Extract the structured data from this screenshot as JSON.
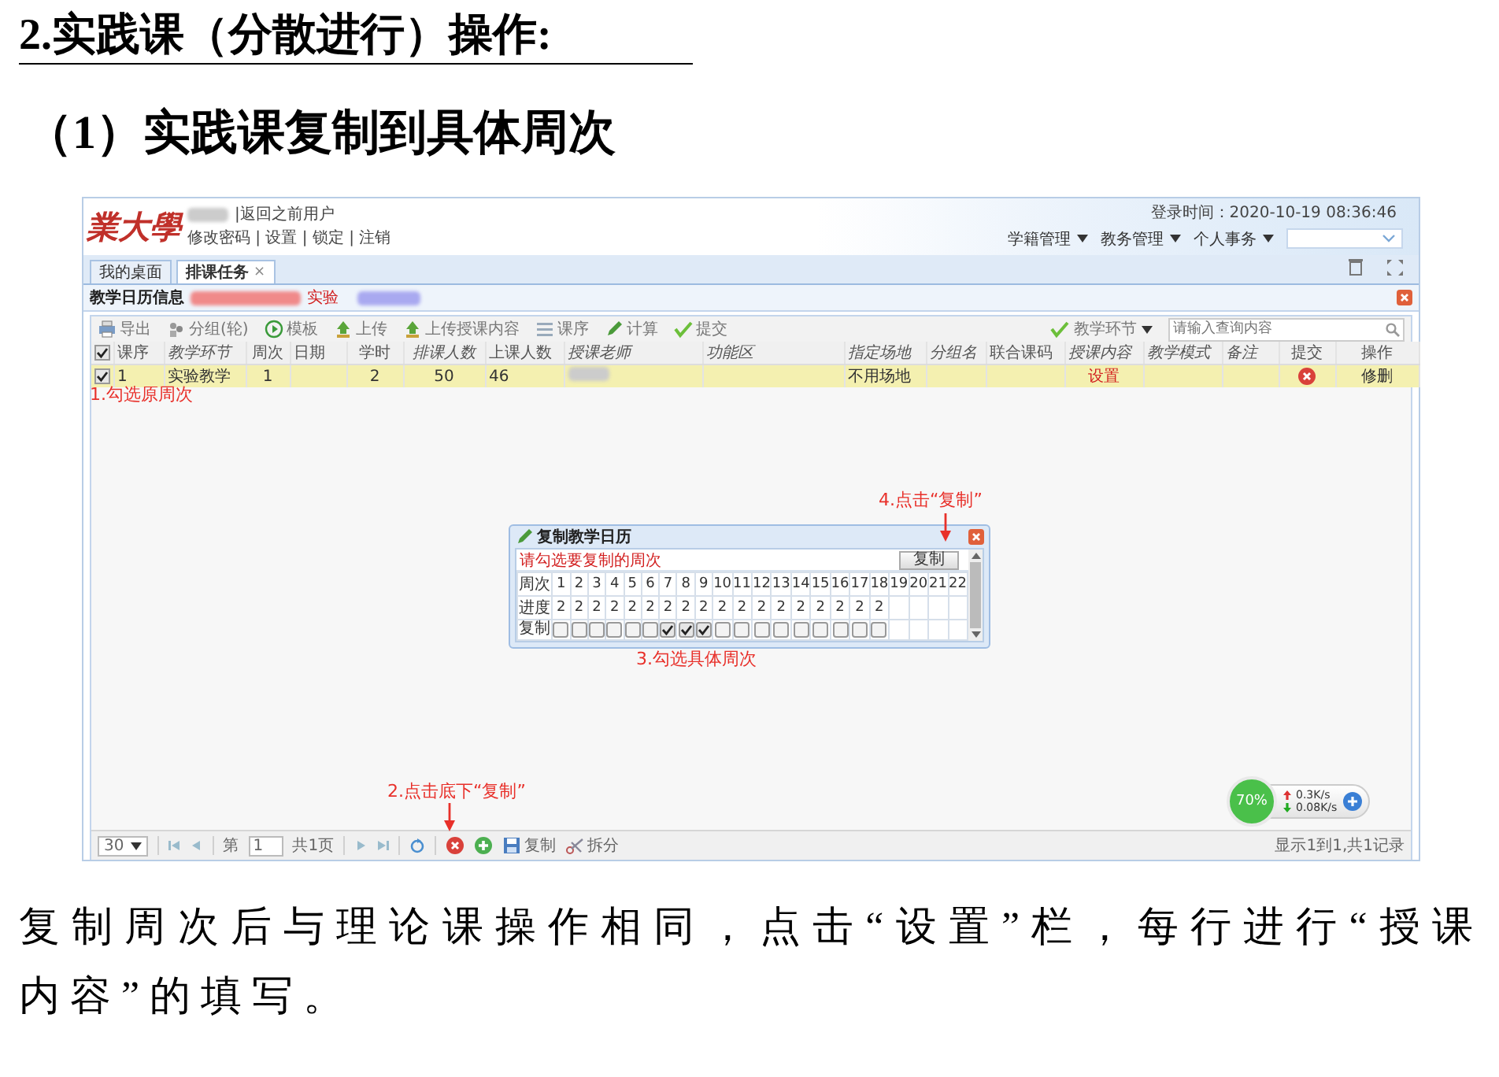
{
  "heading": "2.实践课（分散进行）操作:",
  "subheading": "（1）实践课复制到具体周次",
  "screenshot": {
    "logo": "業大學",
    "return_link": "|返回之前用户",
    "account_links": "修改密码 | 设置 | 锁定 | 注销",
    "login_time": "登录时间：2020-10-19 08:36:46",
    "menus": [
      "学籍管理",
      "教务管理",
      "个人事务"
    ],
    "tabs": [
      {
        "label": "我的桌面",
        "selected": false
      },
      {
        "label": "排课任务",
        "selected": true,
        "close": "×"
      }
    ],
    "panel_title": "教学日历信息",
    "panel_tag": "实验",
    "toolbar": [
      {
        "kind": "print",
        "label": "导出"
      },
      {
        "kind": "group",
        "label": "分组(轮)"
      },
      {
        "kind": "play",
        "label": "模板"
      },
      {
        "kind": "upload",
        "label": "上传"
      },
      {
        "kind": "upload",
        "label": "上传授课内容"
      },
      {
        "kind": "list",
        "label": "课序"
      },
      {
        "kind": "pencil",
        "label": "计算"
      },
      {
        "kind": "check",
        "label": "提交"
      }
    ],
    "filter": {
      "label": "教学环节",
      "placeholder": "请输入查询内容"
    },
    "header_checked": true,
    "columns": [
      {
        "label": "课序",
        "editable": false
      },
      {
        "label": "教学环节",
        "editable": true
      },
      {
        "label": "周次",
        "editable": false
      },
      {
        "label": "日期",
        "editable": false
      },
      {
        "label": "学时",
        "editable": false
      },
      {
        "label": "排课人数",
        "editable": true
      },
      {
        "label": "上课人数",
        "editable": false
      },
      {
        "label": "授课老师",
        "editable": true
      },
      {
        "label": "功能区",
        "editable": true
      },
      {
        "label": "指定场地",
        "editable": true
      },
      {
        "label": "分组名",
        "editable": true
      },
      {
        "label": "联合课码",
        "editable": false
      },
      {
        "label": "授课内容",
        "editable": true
      },
      {
        "label": "教学模式",
        "editable": true
      },
      {
        "label": "备注",
        "editable": true
      },
      {
        "label": "提交",
        "editable": false
      },
      {
        "label": "操作",
        "editable": false
      }
    ],
    "rows": [
      {
        "selected": true,
        "checked": true,
        "cells": [
          "1",
          "实验教学",
          "1",
          null,
          "2",
          "50",
          "46",
          {
            "kind": "redacted"
          },
          null,
          "不用场地",
          null,
          null,
          {
            "kind": "link",
            "text": "设置"
          },
          null,
          null,
          {
            "kind": "delete_icon"
          },
          "修删"
        ]
      }
    ],
    "pager": {
      "page_size": "30",
      "page_label": "第",
      "page": "1",
      "total": "共1页",
      "actions": [
        {
          "kind": "delete"
        },
        {
          "kind": "add"
        },
        {
          "kind": "save",
          "label": "复制"
        },
        {
          "kind": "split",
          "label": "拆分"
        }
      ],
      "summary": "显示1到1,共1记录"
    },
    "dialog": {
      "title": "复制教学日历",
      "prompt": "请勾选要复制的周次",
      "button": "复制",
      "row_labels": [
        "周次",
        "进度",
        "复制"
      ],
      "weeks": [
        {
          "week": "1",
          "progress": "2",
          "checked": false
        },
        {
          "week": "2",
          "progress": "2",
          "checked": false
        },
        {
          "week": "3",
          "progress": "2",
          "checked": false
        },
        {
          "week": "4",
          "progress": "2",
          "checked": false
        },
        {
          "week": "5",
          "progress": "2",
          "checked": false
        },
        {
          "week": "6",
          "progress": "2",
          "checked": false
        },
        {
          "week": "7",
          "progress": "2",
          "checked": true
        },
        {
          "week": "8",
          "progress": "2",
          "checked": true
        },
        {
          "week": "9",
          "progress": "2",
          "checked": true
        },
        {
          "week": "10",
          "progress": "2",
          "checked": false
        },
        {
          "week": "11",
          "progress": "2",
          "checked": false
        },
        {
          "week": "12",
          "progress": "2",
          "checked": false
        },
        {
          "week": "13",
          "progress": "2",
          "checked": false
        },
        {
          "week": "14",
          "progress": "2",
          "checked": false
        },
        {
          "week": "15",
          "progress": "2",
          "checked": false
        },
        {
          "week": "16",
          "progress": "2",
          "checked": false
        },
        {
          "week": "17",
          "progress": "2",
          "checked": false
        },
        {
          "week": "18",
          "progress": "2",
          "checked": false
        },
        {
          "week": "19"
        },
        {
          "week": "20"
        },
        {
          "week": "21"
        },
        {
          "week": "22"
        }
      ]
    },
    "speed": {
      "percent": "70%",
      "upload": "0.3K/s",
      "download": "0.08K/s"
    },
    "annotations": [
      {
        "kind": "step1",
        "text": "1.勾选原周次"
      },
      {
        "kind": "step2",
        "text": "2.点击底下“复制”"
      },
      {
        "kind": "step3",
        "text": "3.勾选具体周次"
      },
      {
        "kind": "step4",
        "text": "4.点击“复制”"
      }
    ]
  },
  "paragraph": "复制周次后与理论课操作相同，点击“设置”栏，每行进行“授课内容”的填写。"
}
